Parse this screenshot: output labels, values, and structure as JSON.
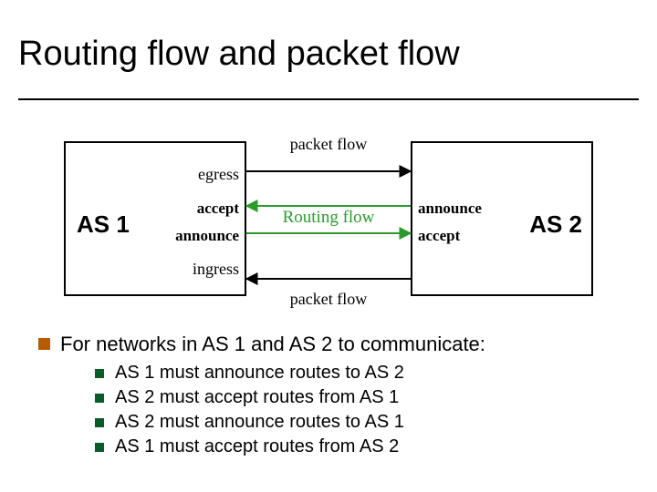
{
  "title": "Routing flow and packet flow",
  "diagram": {
    "as1": {
      "name": "AS 1",
      "egress": "egress",
      "ingress": "ingress",
      "accept": "accept",
      "announce": "announce"
    },
    "as2": {
      "name": "AS 2",
      "announce": "announce",
      "accept": "accept"
    },
    "packet_flow_top": "packet flow",
    "routing_flow": "Routing flow",
    "packet_flow_bottom": "packet flow"
  },
  "body": {
    "lead_for": "For",
    "lead_rest": " networks in AS 1 and AS 2 to communicate:",
    "subs": [
      "AS 1 must announce routes to AS 2",
      "AS 2 must accept routes from AS 1",
      "AS 2 must announce routes to AS 1",
      "AS 1 must accept routes from AS 2"
    ]
  },
  "chart_data": {
    "type": "diagram",
    "nodes": [
      {
        "id": "AS1",
        "label": "AS 1"
      },
      {
        "id": "AS2",
        "label": "AS 2"
      }
    ],
    "edges": [
      {
        "from": "AS1",
        "to": "AS2",
        "port": "egress",
        "label": "packet flow",
        "kind": "packet",
        "color": "black"
      },
      {
        "from": "AS2",
        "to": "AS1",
        "port": "ingress",
        "label": "packet flow",
        "kind": "packet",
        "color": "black"
      },
      {
        "from": "AS1",
        "to": "AS2",
        "label": "Routing flow",
        "as1_side": "announce",
        "as2_side": "accept",
        "kind": "routing",
        "color": "green"
      },
      {
        "from": "AS2",
        "to": "AS1",
        "label": "Routing flow",
        "as1_side": "accept",
        "as2_side": "announce",
        "kind": "routing",
        "color": "green"
      }
    ],
    "notes": [
      "AS 1 must announce routes to AS 2",
      "AS 2 must accept routes from AS 1",
      "AS 2 must announce routes to AS 1",
      "AS 1 must accept routes from AS 2"
    ]
  }
}
